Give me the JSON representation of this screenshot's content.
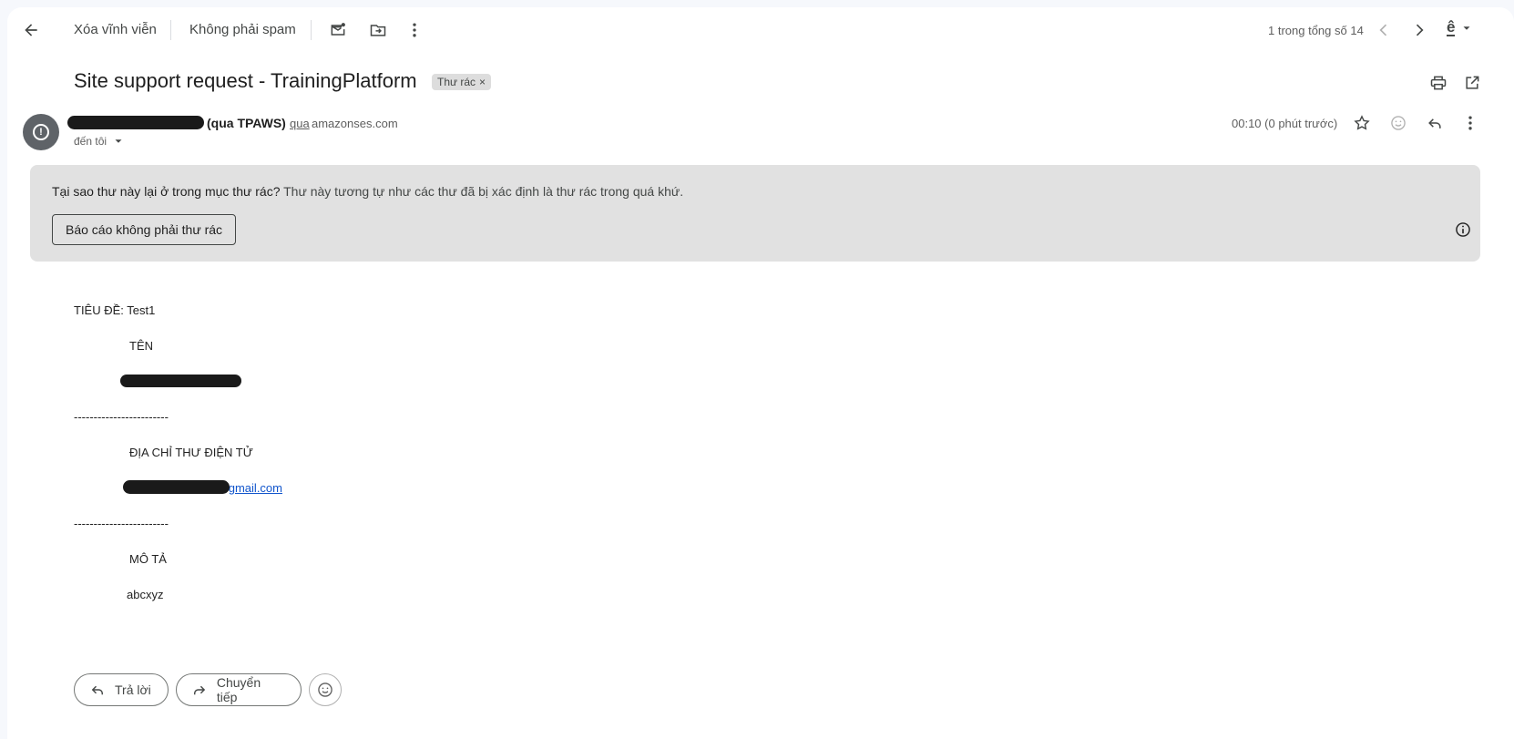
{
  "toolbar": {
    "delete_forever": "Xóa vĩnh viễn",
    "not_spam": "Không phải spam",
    "pagination": "1 trong tổng số 14",
    "input_tool_glyph": "ê"
  },
  "message": {
    "subject": "Site support request - TrainingPlatform",
    "label": "Thư rác",
    "label_remove": "×",
    "sender_suffix": "(qua TPAWS)",
    "via_word": "qua",
    "via_domain": "amazonses.com",
    "recipient": "đến tôi",
    "time": "00:10 (0 phút trước)",
    "avatar_glyph": "!"
  },
  "spam_banner": {
    "question": "Tại sao thư này lại ở trong mục thư rác?",
    "explanation": " Thư này tương tự như các thư đã bị xác định là thư rác trong quá khứ.",
    "report_button": "Báo cáo không phải thư rác"
  },
  "body": {
    "subject_line": "TIÊU ĐỀ: Test1",
    "name_label": "TÊN",
    "separator1": "------------------------",
    "email_label": "ĐỊA CHỈ THƯ ĐIỆN TỬ",
    "email_visible": "gmail.com",
    "separator2": "------------------------",
    "description_label": "MÔ TẢ",
    "description_value": "abcxyz"
  },
  "actions": {
    "reply": "Trả lời",
    "forward": "Chuyển tiếp"
  },
  "icons": {
    "back": "arrow-left-icon",
    "mark_unread": "mail-unread-icon",
    "move": "folder-move-icon",
    "more": "more-vert-icon",
    "prev": "chevron-left-icon",
    "next": "chevron-right-icon",
    "print": "print-icon",
    "open_new": "open-in-new-icon",
    "star": "star-icon",
    "emoji": "emoji-icon",
    "reply": "reply-icon",
    "info": "info-icon",
    "forward": "forward-icon"
  },
  "colors": {
    "banner_bg": "#e1e1e1",
    "link": "#1155cc",
    "avatar_bg": "#5f6368",
    "page_bg": "#f6f8fc"
  }
}
